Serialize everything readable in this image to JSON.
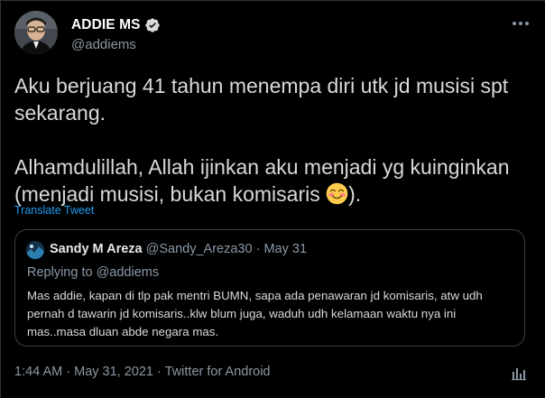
{
  "author": {
    "display_name": "ADDIE MS",
    "handle": "@addiems",
    "verified": true
  },
  "tweet": {
    "line1": "Aku berjuang 41 tahun menempa diri utk jd musisi spt",
    "line2": "sekarang.",
    "line3": "Alhamdulillah, Allah ijinkan aku menjadi yg kuinginkan",
    "line4_a": "(menjadi musisi, bukan komisaris ",
    "line4_emoji": "smiling-face-with-smiling-eyes",
    "line4_b": ").",
    "translate_label": "Translate Tweet"
  },
  "quote": {
    "display_name": "Sandy M Areza",
    "handle": "@Sandy_Areza30",
    "separator": "·",
    "date": "May 31",
    "replying_prefix": "Replying to ",
    "replying_to": "@addiems",
    "text": "Mas addie, kapan di tlp pak mentri BUMN, sapa ada penawaran jd komisaris, atw udh pernah d tawarin jd komisaris..klw blum juga, waduh udh kelamaan waktu nya ini mas..masa dluan abde negara mas."
  },
  "footer": {
    "time": "1:44 AM",
    "sep": "·",
    "date": "May 31, 2021",
    "source": "Twitter for Android"
  },
  "colors": {
    "background": "#000000",
    "text": "#d9d9d9",
    "secondary": "#8b98a5",
    "accent": "#1d9bf0",
    "border": "#3b4046"
  }
}
